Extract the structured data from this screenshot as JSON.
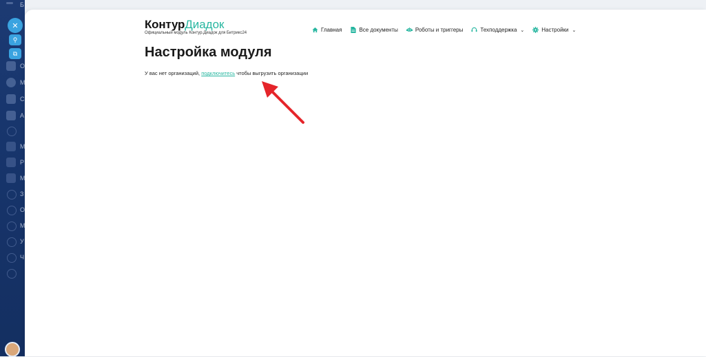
{
  "sidebar": {
    "letters": [
      "Б",
      "О",
      "М",
      "С",
      "А",
      "М",
      "Р",
      "М",
      "З",
      "О",
      "М",
      "У",
      "Ч"
    ]
  },
  "brand": {
    "main": "Контур",
    "accent": "Диадок",
    "subtitle": "Официальный модуль Контур.Диадок для Битрикс24"
  },
  "nav": {
    "home": "Главная",
    "documents": "Все документы",
    "robots": "Роботы и триггеры",
    "support": "Техподдержка",
    "settings": "Настройки"
  },
  "page": {
    "title": "Настройка модуля",
    "message_before": "У вас нет организаций,",
    "link": "подключитесь",
    "message_after": "чтобы выгрузить организации"
  },
  "colors": {
    "accent": "#27b6a0",
    "sidebar": "#1c3a73",
    "arrow": "#e5252a"
  }
}
